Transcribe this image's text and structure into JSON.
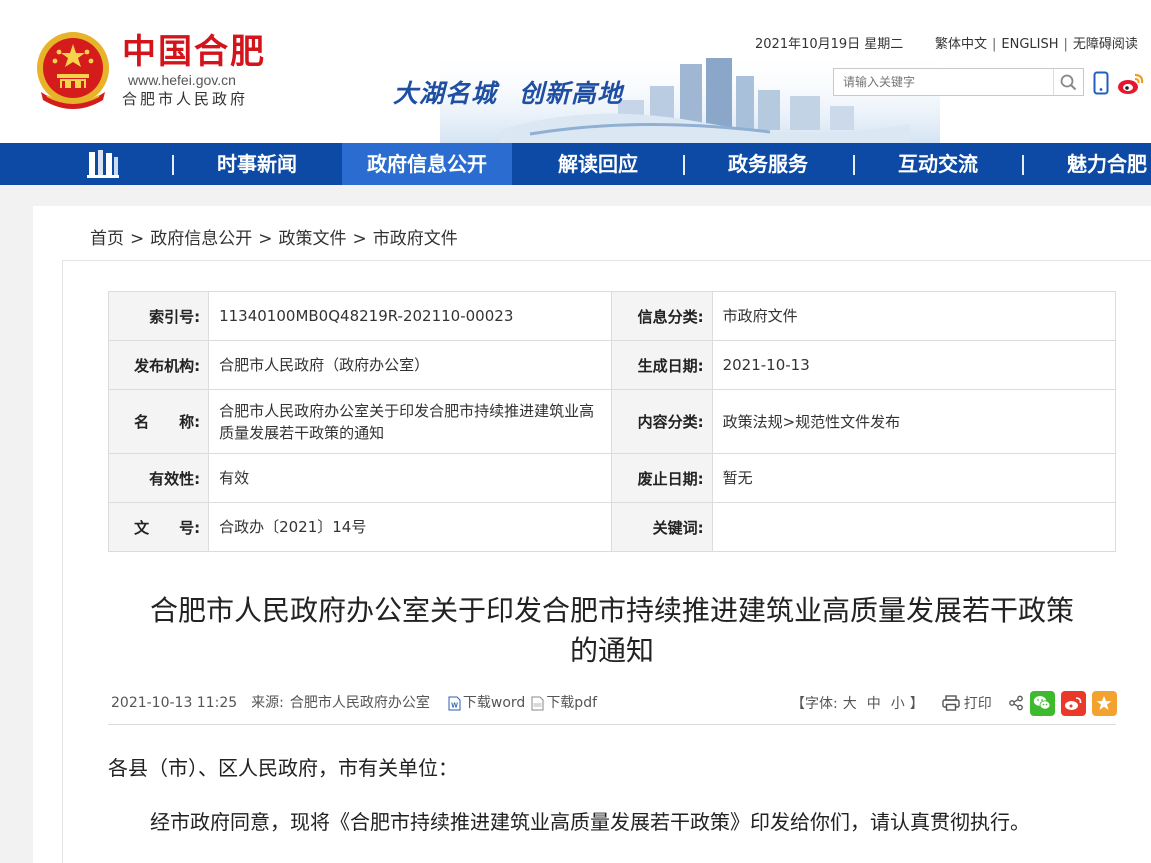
{
  "header": {
    "site_name": "中国合肥",
    "site_domain": "www.hefei.gov.cn",
    "site_subname": "合肥市人民政府",
    "slogan_part1": "大湖名城",
    "slogan_part2": "创新高地",
    "date": "2021年10月19日 星期二",
    "links": [
      "繁体中文",
      "ENGLISH",
      "无障碍阅读"
    ],
    "search_placeholder": "请输入关键字"
  },
  "nav": {
    "items": [
      {
        "label": "时事新闻",
        "active": false
      },
      {
        "label": "政府信息公开",
        "active": true
      },
      {
        "label": "解读回应",
        "active": false
      },
      {
        "label": "政务服务",
        "active": false
      },
      {
        "label": "互动交流",
        "active": false
      },
      {
        "label": "魅力合肥",
        "active": false
      }
    ]
  },
  "breadcrumb": [
    "首页",
    "政府信息公开",
    "政策文件",
    "市政府文件"
  ],
  "meta": {
    "index_label": "索引号:",
    "index_value": "11340100MB0Q48219R-202110-00023",
    "category_label": "信息分类:",
    "category_value": "市政府文件",
    "publisher_label": "发布机构:",
    "publisher_value": "合肥市人民政府（政府办公室）",
    "created_label": "生成日期:",
    "created_value": "2021-10-13",
    "name_label": "名　　称:",
    "name_value": "合肥市人民政府办公室关于印发合肥市持续推进建筑业高质量发展若干政策的通知",
    "content_label": "内容分类:",
    "content_value": "政策法规>规范性文件发布",
    "validity_label": "有效性:",
    "validity_value": "有效",
    "expiry_label": "废止日期:",
    "expiry_value": "暂无",
    "docno_label": "文　　号:",
    "docno_value": "合政办〔2021〕14号",
    "keywords_label": "关键词:",
    "keywords_value": ""
  },
  "article": {
    "title_line1": "合肥市人民政府办公室关于印发合肥市持续推进建筑业高质量发展若干政策",
    "title_line2": "的通知",
    "datetime": "2021-10-13 11:25",
    "source_label": "来源:",
    "source_value": "合肥市人民政府办公室",
    "download_word": "下载word",
    "download_pdf": "下载pdf",
    "font_label_open": "【字体:",
    "font_large": "大",
    "font_medium": "中",
    "font_small": "小",
    "font_label_close": "】",
    "print_label": "打印",
    "salutation": "各县（市）、区人民政府，市有关单位：",
    "paragraph1": "经市政府同意，现将《合肥市持续推进建筑业高质量发展若干政策》印发给你们，请认真贯彻执行。"
  },
  "colors": {
    "brand_red": "#d3151b",
    "nav_blue": "#0c4aa6",
    "nav_active": "#2a6ccf",
    "slogan_blue": "#1f4fa3"
  }
}
